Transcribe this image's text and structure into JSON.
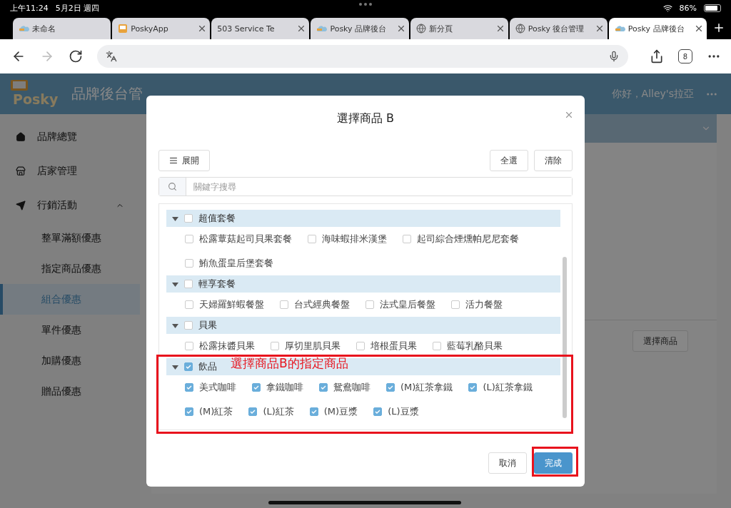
{
  "status_bar": {
    "time": "上午11:24",
    "date": "5月2日 週四",
    "battery": "86%"
  },
  "browser_tabs": [
    {
      "label": "未命名",
      "closable": false,
      "selected": false
    },
    {
      "label": "PoskyApp",
      "closable": true,
      "selected": false
    },
    {
      "label": "503 Service Te",
      "closable": true,
      "selected": false
    },
    {
      "label": "Posky 品牌後台",
      "closable": true,
      "selected": false
    },
    {
      "label": "新分頁",
      "closable": true,
      "selected": false
    },
    {
      "label": "Posky 後台管理",
      "closable": true,
      "selected": false
    },
    {
      "label": "Posky 品牌後台",
      "closable": true,
      "selected": true
    }
  ],
  "toolbar": {
    "tab_count": "8"
  },
  "header": {
    "logo_text": "Posky",
    "title": "品牌後台管",
    "user": "你好，Alley's拉亞"
  },
  "sidebar": {
    "items": [
      {
        "label": "品牌總覽"
      },
      {
        "label": "店家管理"
      },
      {
        "label": "行銷活動",
        "expanded": true,
        "children": [
          {
            "label": "整單滿額優惠",
            "selected": false
          },
          {
            "label": "指定商品優惠",
            "selected": false
          },
          {
            "label": "組合優惠",
            "selected": true
          },
          {
            "label": "單件優惠",
            "selected": false
          },
          {
            "label": "加購優惠",
            "selected": false
          },
          {
            "label": "贈品優惠",
            "selected": false
          }
        ]
      }
    ]
  },
  "content": {
    "select_button": "選擇商品"
  },
  "dialog": {
    "title": "選擇商品 B",
    "expand_button": "展開",
    "select_all_button": "全選",
    "clear_button": "清除",
    "search": {
      "placeholder": "關鍵字搜尋"
    },
    "groups": [
      {
        "label": "超值套餐",
        "checked": false,
        "expanded": true,
        "children": [
          {
            "label": "松露蕈菇起司貝果套餐",
            "checked": false
          },
          {
            "label": "海味蝦排米漢堡",
            "checked": false
          },
          {
            "label": "起司綜合煙燻帕尼尼套餐",
            "checked": false
          },
          {
            "label": "鮪魚蛋皇后堡套餐",
            "checked": false
          }
        ]
      },
      {
        "label": "輕享套餐",
        "checked": false,
        "expanded": true,
        "children": [
          {
            "label": "天婦羅鮮蝦餐盤",
            "checked": false
          },
          {
            "label": "台式經典餐盤",
            "checked": false
          },
          {
            "label": "法式皇后餐盤",
            "checked": false
          },
          {
            "label": "活力餐盤",
            "checked": false
          }
        ]
      },
      {
        "label": "貝果",
        "checked": false,
        "expanded": true,
        "children": [
          {
            "label": "松露抹醬貝果",
            "checked": false
          },
          {
            "label": "厚切里肌貝果",
            "checked": false
          },
          {
            "label": "培根蛋貝果",
            "checked": false
          },
          {
            "label": "藍莓乳酪貝果",
            "checked": false
          }
        ]
      },
      {
        "label": "飲品",
        "checked": true,
        "expanded": true,
        "children": [
          {
            "label": "美式咖啡",
            "checked": true
          },
          {
            "label": "拿鐵咖啡",
            "checked": true
          },
          {
            "label": "鴛鴦咖啡",
            "checked": true
          },
          {
            "label": "(M)紅茶拿鐵",
            "checked": true
          },
          {
            "label": "(L)紅茶拿鐵",
            "checked": true
          },
          {
            "label": "(M)紅茶",
            "checked": true
          },
          {
            "label": "(L)紅茶",
            "checked": true
          },
          {
            "label": "(M)豆漿",
            "checked": true
          },
          {
            "label": "(L)豆漿",
            "checked": true
          }
        ]
      }
    ],
    "cancel_button": "取消",
    "done_button": "完成"
  },
  "annotation": {
    "label": "選擇商品B的指定商品"
  }
}
